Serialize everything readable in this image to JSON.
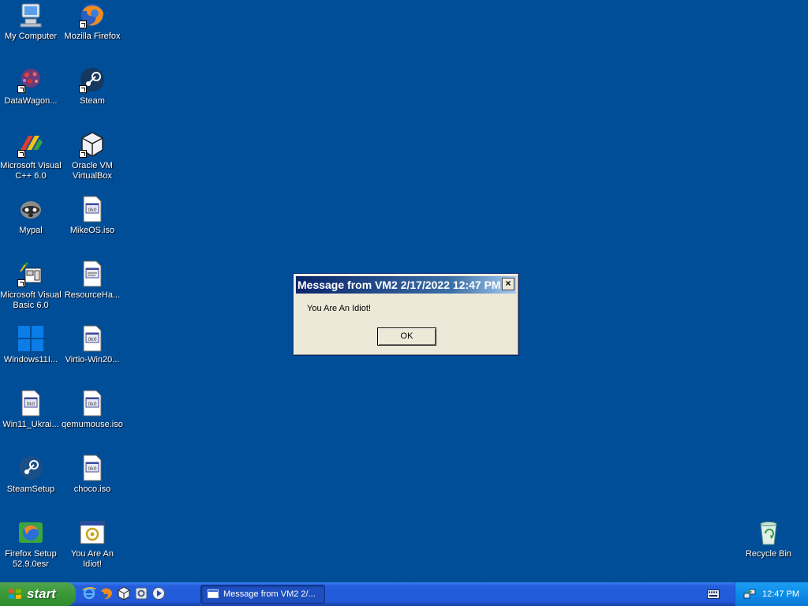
{
  "desktop": {
    "icons": [
      {
        "id": "my-computer",
        "label": "My Computer",
        "icon": "computer-icon"
      },
      {
        "id": "mozilla-firefox",
        "label": "Mozilla Firefox",
        "icon": "firefox-icon"
      },
      {
        "id": "datawagon",
        "label": "DataWagon...",
        "icon": "datawagon-icon"
      },
      {
        "id": "steam",
        "label": "Steam",
        "icon": "steam-icon"
      },
      {
        "id": "ms-visual-cpp",
        "label": "Microsoft Visual\nC++ 6.0",
        "icon": "visual-cpp-icon"
      },
      {
        "id": "oracle-vbox",
        "label": "Oracle VM\nVirtualBox",
        "icon": "virtualbox-icon"
      },
      {
        "id": "mypal",
        "label": "Mypal",
        "icon": "mypal-icon"
      },
      {
        "id": "mikeos-iso",
        "label": "MikeOS.iso",
        "icon": "iso-file-icon"
      },
      {
        "id": "ms-visual-basic",
        "label": "Microsoft Visual\nBasic 6.0",
        "icon": "visual-basic-icon"
      },
      {
        "id": "resourceha",
        "label": "ResourceHa...",
        "icon": "exe-file-icon"
      },
      {
        "id": "windows11",
        "label": "Windows11I...",
        "icon": "windows11-icon"
      },
      {
        "id": "virtio-win",
        "label": "Virtio-Win20...",
        "icon": "iso-file-icon"
      },
      {
        "id": "win11-ukrai",
        "label": "Win11_Ukrai...",
        "icon": "iso-file-icon"
      },
      {
        "id": "qemumouse",
        "label": "qemumouse.iso",
        "icon": "iso-file-icon"
      },
      {
        "id": "steamsetup",
        "label": "SteamSetup",
        "icon": "steam-setup-icon"
      },
      {
        "id": "choco-iso",
        "label": "choco.iso",
        "icon": "iso-file-icon"
      },
      {
        "id": "firefox-setup",
        "label": "Firefox Setup\n52.9.0esr",
        "icon": "firefox-setup-icon"
      },
      {
        "id": "you-are-an-idiot",
        "label": "You Are An\nIdiot!",
        "icon": "program-icon"
      },
      {
        "id": "recycle-bin",
        "label": "Recycle Bin",
        "icon": "recycle-bin-icon"
      }
    ]
  },
  "dialog": {
    "title": "Message from VM2 2/17/2022 12:47 PM",
    "close_label": "×",
    "message": "You Are An Idiot!",
    "ok_label": "OK"
  },
  "taskbar": {
    "start_label": "start",
    "quick_launch": [
      "internet-explorer-icon",
      "firefox-icon",
      "virtualbox-icon",
      "settings-icon",
      "media-player-icon"
    ],
    "task_label": "Message from VM2 2/...",
    "clock": "12:47 PM"
  },
  "colors": {
    "desktop_bg": "#004E98",
    "taskbar_blue": "#245EDC",
    "start_green": "#3C9B3A",
    "tray_blue": "#0C8DE8"
  }
}
